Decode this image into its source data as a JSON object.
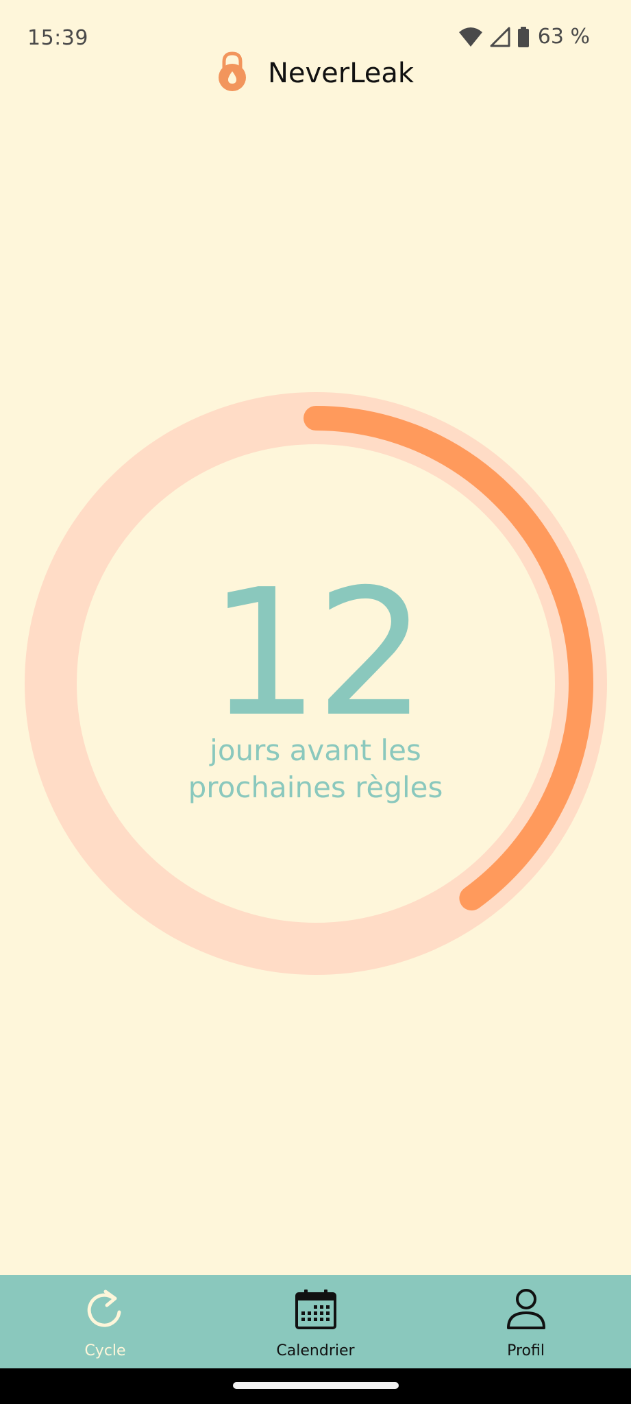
{
  "status_bar": {
    "time": "15:39",
    "battery": "63 %",
    "icons": [
      "wifi-icon",
      "signal-icon",
      "battery-icon"
    ]
  },
  "app": {
    "name": "NeverLeak",
    "logo_icon": "lock-drop-icon"
  },
  "cycle": {
    "days_remaining": "12",
    "caption_line1": "jours avant les",
    "caption_line2": "prochaines règles",
    "progress_fraction": 0.4,
    "colors": {
      "ring_track": "#FFDCC6",
      "ring_progress": "#FF9A5C",
      "text": "#8AC8BD"
    }
  },
  "bottom_nav": {
    "items": [
      {
        "label": "Cycle",
        "icon": "refresh-icon",
        "active": true
      },
      {
        "label": "Calendrier",
        "icon": "calendar-icon",
        "active": false
      },
      {
        "label": "Profil",
        "icon": "user-icon",
        "active": false
      }
    ]
  },
  "colors": {
    "background": "#FEF6DA",
    "nav_background": "#8AC8BD",
    "accent": "#F2955C"
  }
}
